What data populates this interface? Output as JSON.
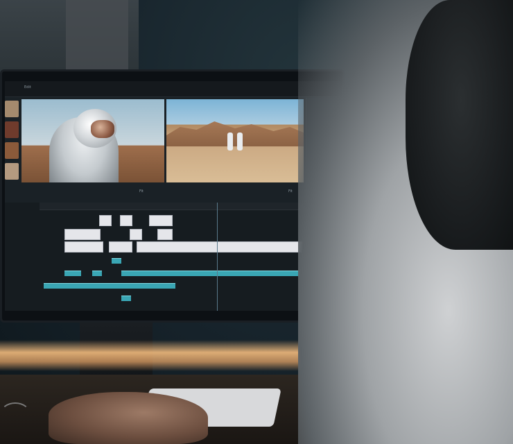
{
  "scene": {
    "subject": "",
    "colors": {
      "screen_bg": "#1a2126",
      "clip_video": "#e5e6ea",
      "clip_audio": "#3aa6b4",
      "lamp_glow": "#ffc482"
    }
  },
  "editor": {
    "topbar": {
      "left_label": "Edit",
      "center_label": "",
      "right_label_1": "",
      "right_label_2": ""
    },
    "controls": {
      "left_fit": "Fit",
      "right_fit": "Fit"
    }
  }
}
